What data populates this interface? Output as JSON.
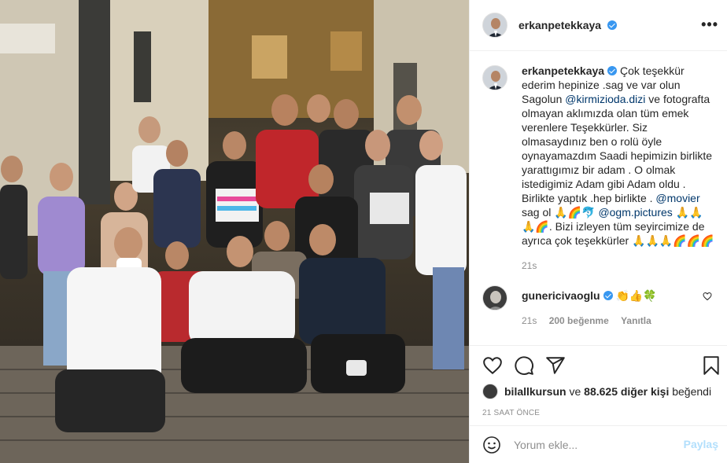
{
  "post": {
    "author": "erkanpetekkaya",
    "verified": true,
    "more_icon": "more-options-icon"
  },
  "caption": {
    "username": "erkanpetekkaya",
    "text_1": "Çok teşekkür ederim hepinize .sag ve var olun Sagolun ",
    "mention_1": "@kirmizioda.dizi",
    "text_2": " ve fotografta olmayan aklımızda olan tüm emek verenlere Teşekkürler. Siz olmasaydınız ben o rolü öyle oynayamazdım Saadi hepimizin birlikte yarattıgımız bir adam . O olmak istedigimiz Adam gibi Adam oldu . Birlikte yaptık .hep birlikte . ",
    "mention_2": "@movier",
    "text_3": " sag ol 🙏🌈🐬 ",
    "mention_3": "@ogm.pictures",
    "text_4": " 🙏🙏🙏🌈. Bizi izleyen tüm seyircimize de ayrıca çok teşekkürler 🙏🙏🙏🌈🌈🌈",
    "age": "21s"
  },
  "comment": {
    "username": "gunericivaoglu",
    "text": "👏👍🍀",
    "age": "21s",
    "likes": "200 beğenme",
    "reply": "Yanıtla"
  },
  "actions": {
    "like_icon": "heart-icon",
    "comment_icon": "comment-icon",
    "share_icon": "share-icon",
    "save_icon": "bookmark-icon"
  },
  "likes": {
    "user": "bilallkursun",
    "connector": " ve ",
    "count": "88.625 diğer kişi",
    "suffix": " beğendi"
  },
  "timestamp": "21 SAAT ÖNCE",
  "add_comment": {
    "placeholder": "Yorum ekle...",
    "post_label": "Paylaş",
    "emoji_icon": "emoji-icon"
  }
}
